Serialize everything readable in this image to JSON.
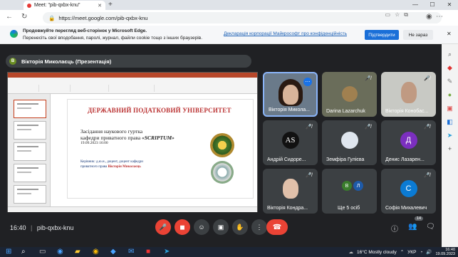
{
  "browser": {
    "tab_title": "Meet: \"pib-qxbx-knu\"",
    "new_tab": "+",
    "url": "https://meet.google.com/pib-qxbx-knu",
    "min": "—",
    "max": "☐",
    "close": "✕"
  },
  "notice": {
    "title": "Продовжуйте перегляд веб-сторінок у Microsoft Edge.",
    "text": "Перенесіть свої вподобання, паролі, журнал, файли cookie тощо з інших браузерів.",
    "link": "Декларація корпорації Майкрософт про конфіденційність",
    "confirm": "Підтвердити",
    "later": "Не зараз"
  },
  "meet": {
    "presenter_initial": "В",
    "presenter": "Вікторія Миколаєць (Презентація)",
    "meeting_code": "pib-qxbx-knu",
    "time": "16:40",
    "participants_count": "14"
  },
  "slide": {
    "university": "ДЕРЖАВНИЙ ПОДАТКОВИЙ УНІВЕРСИТЕТ",
    "line1": "Засідання наукового гуртка",
    "line2_prefix": "кафедри приватного права ",
    "line2_name": "«SCRIPTUM»",
    "date": "19.09.2023   16:00",
    "lead1": "Керівник: д.ю.н., доцент, доцент кафедри",
    "lead2_prefix": "приватного права ",
    "lead2_name": "Вікторія Миколаєць"
  },
  "participants": [
    {
      "name": "Вікторія Микола...",
      "initial": ""
    },
    {
      "name": "Darina Lazarchuk",
      "initial": ""
    },
    {
      "name": "Вікторія Конобас...",
      "initial": ""
    },
    {
      "name": "Андрій Сидоре...",
      "initial": "AS"
    },
    {
      "name": "Земфіра Гулієва",
      "initial": ""
    },
    {
      "name": "Денис Лазарен...",
      "initial": "Д"
    },
    {
      "name": "Вікторія Кондра...",
      "initial": ""
    },
    {
      "name": "Ще 5 осіб",
      "initial": "В Л"
    },
    {
      "name": "Софія Михалевич",
      "initial": "С"
    }
  ],
  "taskbar": {
    "weather": "16°C  Mostly cloudy",
    "lang": "УКР",
    "time": "16:40",
    "date": "19.09.2023"
  },
  "colors": {
    "meet_bg": "#202124",
    "tile_bg": "#3c4043",
    "end_call": "#ea4335",
    "edge_blue": "#1a6fd8"
  }
}
